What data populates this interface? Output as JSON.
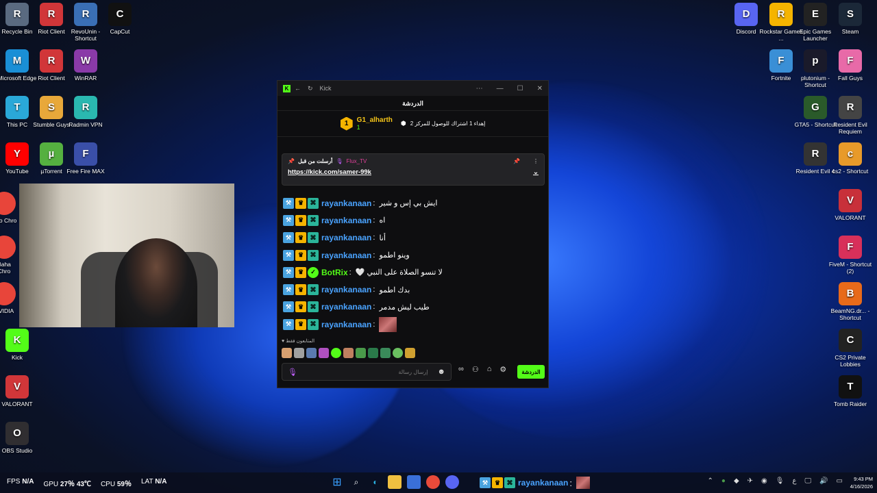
{
  "desktop": {
    "left_icons": [
      {
        "label": "Recycle Bin",
        "icon": "recycle-bin-icon",
        "color": "#5a6a80"
      },
      {
        "label": "Riot Client",
        "icon": "riot-icon",
        "color": "#d13639"
      },
      {
        "label": "RevoUnin - Shortcut",
        "icon": "revo-icon",
        "color": "#3a6fb5"
      },
      {
        "label": "CapCut",
        "icon": "capcut-icon",
        "color": "#111111"
      },
      {
        "label": "Microsoft Edge",
        "icon": "edge-icon",
        "color": "#1a8fd6"
      },
      {
        "label": "Riot Client",
        "icon": "riot-icon",
        "color": "#d13639"
      },
      {
        "label": "WinRAR",
        "icon": "winrar-icon",
        "color": "#8a3aa8"
      },
      {
        "label": "This PC",
        "icon": "pc-icon",
        "color": "#2aa8d8"
      },
      {
        "label": "Stumble Guys",
        "icon": "stumble-icon",
        "color": "#e8a83a"
      },
      {
        "label": "Radmin VPN",
        "icon": "radmin-icon",
        "color": "#2ab8b0"
      },
      {
        "label": "YouTube",
        "icon": "youtube-icon",
        "color": "#ff0000"
      },
      {
        "label": "µTorrent",
        "icon": "utorrent-icon",
        "color": "#55b040"
      },
      {
        "label": "Free Fire MAX",
        "icon": "freefire-icon",
        "color": "#3a4fa8"
      },
      {
        "label": "Kick",
        "icon": "kick-icon",
        "color": "#53fc18"
      },
      {
        "label": "VALORANT",
        "icon": "riot-icon",
        "color": "#d13639"
      },
      {
        "label": "OBS Studio",
        "icon": "obs-icon",
        "color": "#302e31"
      }
    ],
    "partial_icons": [
      {
        "label": "Goo Chro",
        "icon": "chrome-icon"
      },
      {
        "label": "Baha Chro",
        "icon": "chrome-icon"
      },
      {
        "label": "NVIDIA",
        "icon": "nvidia-icon"
      }
    ],
    "right_icons": [
      {
        "label": "Discord",
        "icon": "discord-icon",
        "color": "#5865f2"
      },
      {
        "label": "Rockstar Games ...",
        "icon": "rockstar-icon",
        "color": "#f5b400"
      },
      {
        "label": "Epic Games Launcher",
        "icon": "epic-icon",
        "color": "#222222"
      },
      {
        "label": "Steam",
        "icon": "steam-icon",
        "color": "#1b2838"
      },
      {
        "label": "Fortnite",
        "icon": "fortnite-icon",
        "color": "#3a8fd6"
      },
      {
        "label": "plutonium - Shortcut",
        "icon": "plutonium-icon",
        "color": "#1a1a2a"
      },
      {
        "label": "Fall Guys",
        "icon": "fallguys-icon",
        "color": "#e86aa8"
      },
      {
        "label": "GTA5 - Shortcut",
        "icon": "gta-icon",
        "color": "#2a5a2a"
      },
      {
        "label": "Resident Evil Requiem",
        "icon": "re-icon",
        "color": "#444444"
      },
      {
        "label": "Resident Evil 4",
        "icon": "re-icon",
        "color": "#333333"
      },
      {
        "label": "cs2 - Shortcut",
        "icon": "cs2-icon",
        "color": "#e89a2a"
      },
      {
        "label": "VALORANT",
        "icon": "valorant-icon",
        "color": "#c8303a"
      },
      {
        "label": "FiveM - Shortcut (2)",
        "icon": "fivem-icon",
        "color": "#d8305a"
      },
      {
        "label": "BeamNG.dr... - Shortcut",
        "icon": "beamng-icon",
        "color": "#e86a1a"
      },
      {
        "label": "CS2 Private Lobbies",
        "icon": "cs2-icon",
        "color": "#222222"
      },
      {
        "label": "Tomb Raider",
        "icon": "tombraider-icon",
        "color": "#111111"
      }
    ]
  },
  "kick_window": {
    "title": "Kick",
    "chat_header": "الدردشة",
    "leaderboard": {
      "rank": "1",
      "user": "G1_alharth",
      "count": "1",
      "gift_text": "إهداء 1 اشتراك للوصول للمركز 2"
    },
    "pinned": {
      "label": "أرسلت من قبل",
      "author": "Flux_TV",
      "link": "https://kick.com/samer-99k"
    },
    "messages": [
      {
        "user": "rayankanaan",
        "text": "ايش بي إس و شير",
        "bot": false
      },
      {
        "user": "rayankanaan",
        "text": "اه",
        "bot": false
      },
      {
        "user": "rayankanaan",
        "text": "أنا",
        "bot": false
      },
      {
        "user": "rayankanaan",
        "text": "وينو اطمو",
        "bot": false
      },
      {
        "user": "BotRix",
        "text": "🤍 لا تنسو الصلاة على النبي",
        "bot": true
      },
      {
        "user": "rayankanaan",
        "text": "بدك اطمو",
        "bot": false
      },
      {
        "user": "rayankanaan",
        "text": "طيب ليش مدمر",
        "bot": false
      },
      {
        "user": "rayankanaan",
        "text": "",
        "bot": false,
        "image": true
      }
    ],
    "followers_only": "المتابعون فقط",
    "input_placeholder": "إرسال رسالة",
    "send_button": "الدردشة"
  },
  "taskbar": {
    "fps_label": "FPS",
    "fps_value": "N/A",
    "gpu_label": "GPU",
    "gpu_value": "27％ 43℃",
    "cpu_label": "CPU",
    "cpu_value": "59％",
    "lat_label": "LAT",
    "lat_value": "N/A",
    "overlay_user": "rayankanaan",
    "time": "9:43 PM",
    "date": "4/16/2026"
  }
}
